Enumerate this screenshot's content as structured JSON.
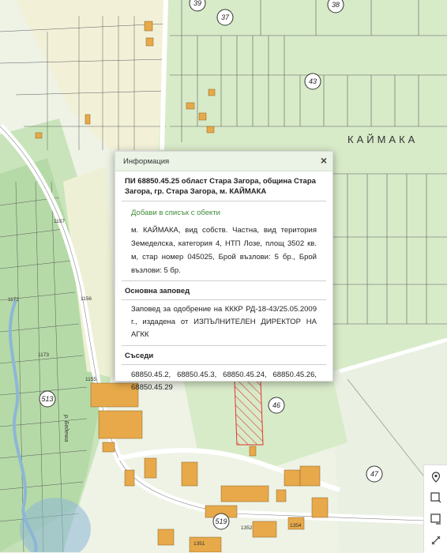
{
  "popup": {
    "header": "Информация",
    "close_symbol": "×",
    "parcel_title": "ПИ 68850.45.25 област Стара Загора, община Стара Загора, гр. Стара Загора, м. КАЙМАКА",
    "add_to_list": "Добави в списък с обекти",
    "description": "м. КАЙМАКА, вид собств. Частна, вид територия Земеделска, категория 4, НТП Лозе, площ 3502 кв. м, стар номер 045025, Брой възлови: 5 бр., Брой възлови: 5 бр.",
    "order_heading": "Основна заповед",
    "order_text": "Заповед за одобрение на КККР РД-18-43/25.05.2009 г., издадена от ИЗПЪЛНИТЕЛЕН ДИРЕКТОР НА АГКК",
    "neighbors_heading": "Съседи",
    "neighbors_text": "68850.45.2, 68850.45.3, 68850.45.24, 68850.45.26, 68850.45.29"
  },
  "map": {
    "place_name": "КАЙМАКА",
    "circle_labels": [
      "39",
      "37",
      "38",
      "43",
      "513",
      "46",
      "519",
      "47"
    ],
    "street_labels": [
      "1157",
      "1156",
      "1155",
      "1173",
      "1172",
      "1352",
      "1351",
      "1354"
    ],
    "river_label": "р. Бедечка",
    "colors": {
      "light_green": "#d8ebc9",
      "mid_green": "#a9d49a",
      "yellowish": "#f2f1d8",
      "building": "#e7a94a",
      "road": "#ffffff",
      "water": "#8cb7d6",
      "highlight": "#e0362c"
    }
  },
  "controls": {
    "icons": [
      "location-pin-icon",
      "draw-polygon-icon",
      "measure-area-icon",
      "measure-distance-icon"
    ]
  }
}
